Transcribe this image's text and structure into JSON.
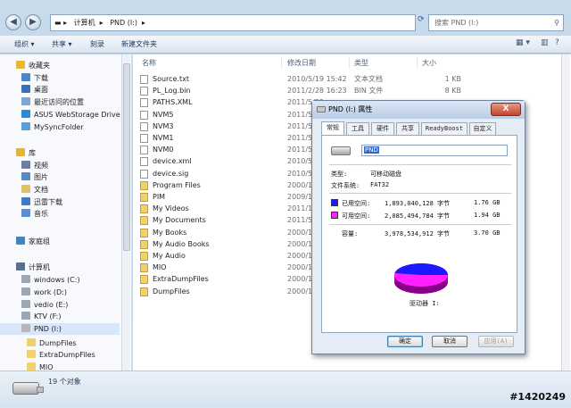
{
  "address": {
    "back_icon": "back-arrow-icon",
    "forward_icon": "forward-arrow-icon",
    "path": [
      "计算机",
      "PND (I:)"
    ],
    "search_placeholder": "搜索 PND (I:)"
  },
  "toolbar": {
    "organize": "组织 ▾",
    "share": "共享 ▾",
    "burn": "刻录",
    "new_folder": "新建文件夹",
    "view_glyph": "▦ ▾",
    "pane_glyph": "▥",
    "help_glyph": "?"
  },
  "nav": [
    {
      "label": "收藏夹",
      "icon": "star-icon",
      "color": "#e8b931"
    },
    {
      "label": "下载",
      "icon": "download-folder-icon",
      "color": "#4a86c8"
    },
    {
      "label": "桌面",
      "icon": "desktop-icon",
      "color": "#3a6fb5"
    },
    {
      "label": "最近访问的位置",
      "icon": "recent-places-icon",
      "color": "#7fa6cf"
    },
    {
      "label": "ASUS WebStorage Drive",
      "icon": "cloud-drive-icon",
      "color": "#2b8ad8"
    },
    {
      "label": "MySyncFolder",
      "icon": "sync-folder-icon",
      "color": "#57a0e0"
    },
    {
      "label": "库",
      "icon": "library-icon",
      "color": "#e0b443"
    },
    {
      "label": "视频",
      "icon": "video-library-icon",
      "color": "#6c7ea3"
    },
    {
      "label": "图片",
      "icon": "pictures-library-icon",
      "color": "#4f8bc4"
    },
    {
      "label": "文档",
      "icon": "documents-library-icon",
      "color": "#dfc067"
    },
    {
      "label": "迅雷下载",
      "icon": "thunder-download-icon",
      "color": "#3b7bd0"
    },
    {
      "label": "音乐",
      "icon": "music-library-icon",
      "color": "#5c8fd1"
    },
    {
      "label": "家庭组",
      "icon": "homegroup-icon",
      "color": "#3b86c4"
    },
    {
      "label": "计算机",
      "icon": "computer-icon",
      "color": "#5a6f8c"
    },
    {
      "label": "windows (C:)",
      "icon": "local-disk-icon",
      "color": "#9aa7b5"
    },
    {
      "label": "work (D:)",
      "icon": "local-disk-icon",
      "color": "#9aa7b5"
    },
    {
      "label": "vedio (E:)",
      "icon": "local-disk-icon",
      "color": "#9aa7b5"
    },
    {
      "label": "KTV (F:)",
      "icon": "local-disk-icon",
      "color": "#9aa7b5"
    },
    {
      "label": "PND (I:)",
      "icon": "removable-disk-icon",
      "color": "#b6b6b6"
    },
    {
      "label": "DumpFiles",
      "icon": "folder-icon",
      "color": "#f4d06c"
    },
    {
      "label": "ExtraDumpFiles",
      "icon": "folder-icon",
      "color": "#f4d06c"
    },
    {
      "label": "MIO",
      "icon": "folder-icon",
      "color": "#f4d06c"
    }
  ],
  "columns": {
    "name": "名称",
    "date": "修改日期",
    "type": "类型",
    "size": "大小"
  },
  "files": [
    {
      "name": "Source.txt",
      "date": "2010/5/19 15:42",
      "type": "文本文档",
      "size": "1 KB",
      "kind": "file"
    },
    {
      "name": "PL_Log.bin",
      "date": "2011/2/28 16:23",
      "type": "BIN 文件",
      "size": "8 KB",
      "kind": "file"
    },
    {
      "name": "PATHS.XML",
      "date": "2011/5/29",
      "type": "",
      "size": "",
      "kind": "file"
    },
    {
      "name": "NVM5",
      "date": "2011/5/29",
      "type": "",
      "size": "",
      "kind": "file"
    },
    {
      "name": "NVM3",
      "date": "2011/5/29",
      "type": "",
      "size": "",
      "kind": "file"
    },
    {
      "name": "NVM1",
      "date": "2011/5/29",
      "type": "",
      "size": "",
      "kind": "file"
    },
    {
      "name": "NVM0",
      "date": "2011/5/29",
      "type": "",
      "size": "",
      "kind": "file"
    },
    {
      "name": "device.xml",
      "date": "2010/5/19",
      "type": "",
      "size": "",
      "kind": "file"
    },
    {
      "name": "device.sig",
      "date": "2010/5/19",
      "type": "",
      "size": "",
      "kind": "file"
    },
    {
      "name": "Program Files",
      "date": "2000/1/1",
      "type": "",
      "size": "",
      "kind": "folder"
    },
    {
      "name": "PIM",
      "date": "2009/1/1",
      "type": "",
      "size": "",
      "kind": "folder"
    },
    {
      "name": "My Videos",
      "date": "2011/1/1",
      "type": "",
      "size": "",
      "kind": "folder"
    },
    {
      "name": "My Documents",
      "date": "2011/5/29",
      "type": "",
      "size": "",
      "kind": "folder"
    },
    {
      "name": "My Books",
      "date": "2000/1/1",
      "type": "",
      "size": "",
      "kind": "folder"
    },
    {
      "name": "My Audio Books",
      "date": "2000/1/1",
      "type": "",
      "size": "",
      "kind": "folder"
    },
    {
      "name": "My Audio",
      "date": "2000/1/1",
      "type": "",
      "size": "",
      "kind": "folder"
    },
    {
      "name": "MIO",
      "date": "2000/1/1",
      "type": "",
      "size": "",
      "kind": "folder"
    },
    {
      "name": "ExtraDumpFiles",
      "date": "2000/1/1",
      "type": "",
      "size": "",
      "kind": "folder"
    },
    {
      "name": "DumpFiles",
      "date": "2000/1/1",
      "type": "",
      "size": "",
      "kind": "folder"
    }
  ],
  "status": {
    "count": "19 个对象"
  },
  "watermark": "#1420249",
  "dialog": {
    "title": "PND (I:) 属性",
    "close": "X",
    "tabs": [
      "常规",
      "工具",
      "硬件",
      "共享",
      "ReadyBoost",
      "自定义"
    ],
    "name_value": "PND",
    "type_label": "类型:",
    "type_value": "可移动磁盘",
    "fs_label": "文件系统:",
    "fs_value": "FAT32",
    "used_label": "已用空间:",
    "used_bytes": "1,893,040,128 字节",
    "used_gb": "1.76 GB",
    "used_color": "#1a1aff",
    "free_label": "可用空间:",
    "free_bytes": "2,085,494,784 字节",
    "free_gb": "1.94 GB",
    "free_color": "#ff22ff",
    "cap_label": "容量:",
    "cap_bytes": "3,978,534,912 字节",
    "cap_gb": "3.70 GB",
    "drive_caption": "驱动器 I:",
    "ok": "确定",
    "cancel": "取消",
    "apply": "应用(A)"
  }
}
